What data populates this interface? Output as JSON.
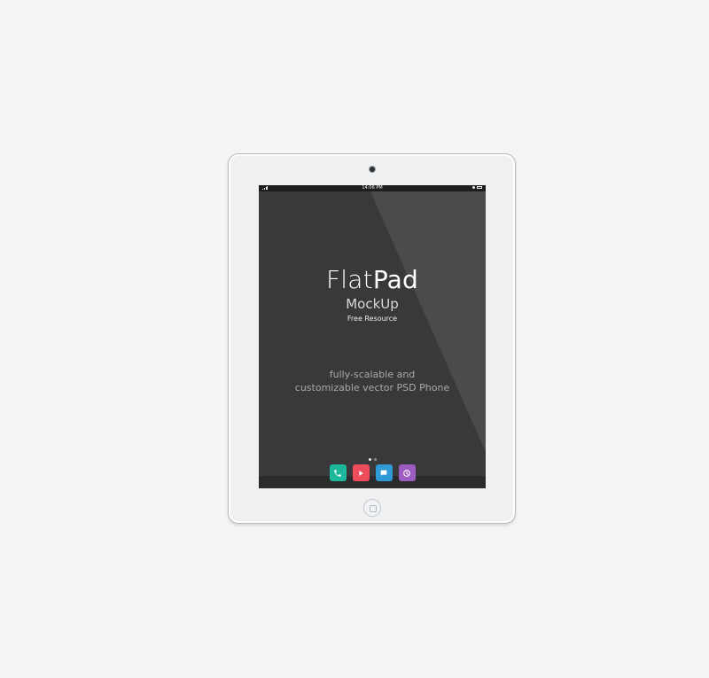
{
  "status_bar": {
    "time": "14:06 PM"
  },
  "hero": {
    "title_light": "Flat",
    "title_bold": "Pad",
    "subtitle": "MockUp",
    "tagline": "Free Resource"
  },
  "description": {
    "line1": "fully-scalable and",
    "line2": "customizable vector PSD Phone"
  },
  "dock": {
    "icons": [
      {
        "name": "phone-icon",
        "color": "#1db89b"
      },
      {
        "name": "play-icon",
        "color": "#ef4c5b"
      },
      {
        "name": "message-icon",
        "color": "#2f9ad6"
      },
      {
        "name": "clock-icon",
        "color": "#9c5cc2"
      }
    ]
  },
  "colors": {
    "device_body": "#eef0f1",
    "screen": "#39393b",
    "page_background": "#f5f5f5"
  },
  "page_dots": {
    "count": 2,
    "active_index": 0
  }
}
